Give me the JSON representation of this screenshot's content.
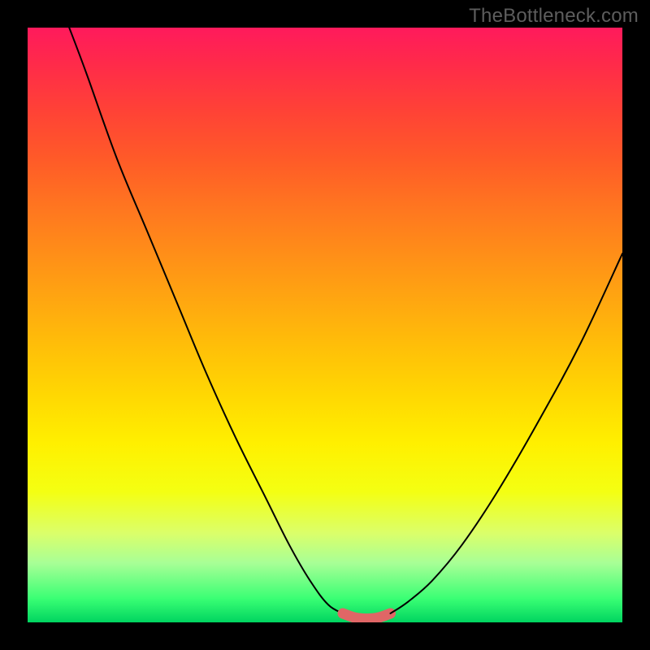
{
  "watermark": "TheBottleneck.com",
  "chart_data": {
    "type": "line",
    "title": "",
    "xlabel": "",
    "ylabel": "",
    "xlim": [
      0,
      100
    ],
    "ylim": [
      0,
      100
    ],
    "grid": false,
    "legend": false,
    "series": [
      {
        "name": "left-curve",
        "color": "#000000",
        "x": [
          7,
          10,
          15,
          20,
          25,
          30,
          35,
          40,
          44,
          47.5,
          50.5,
          53
        ],
        "y": [
          100,
          92,
          78,
          66,
          54,
          42,
          31,
          21,
          13,
          7,
          3,
          1.5
        ]
      },
      {
        "name": "trough-band",
        "color": "#e06666",
        "thick": true,
        "x": [
          53,
          55,
          57,
          59,
          61
        ],
        "y": [
          1.5,
          0.8,
          0.6,
          0.8,
          1.5
        ]
      },
      {
        "name": "right-curve",
        "color": "#000000",
        "x": [
          61,
          64,
          68,
          73,
          79,
          86,
          93,
          100
        ],
        "y": [
          1.5,
          3.5,
          7,
          13,
          22,
          34,
          47,
          62
        ]
      }
    ],
    "background_gradient": {
      "top_color": "#ff1a5c",
      "mid_color": "#fff000",
      "bottom_color": "#00d460"
    }
  }
}
